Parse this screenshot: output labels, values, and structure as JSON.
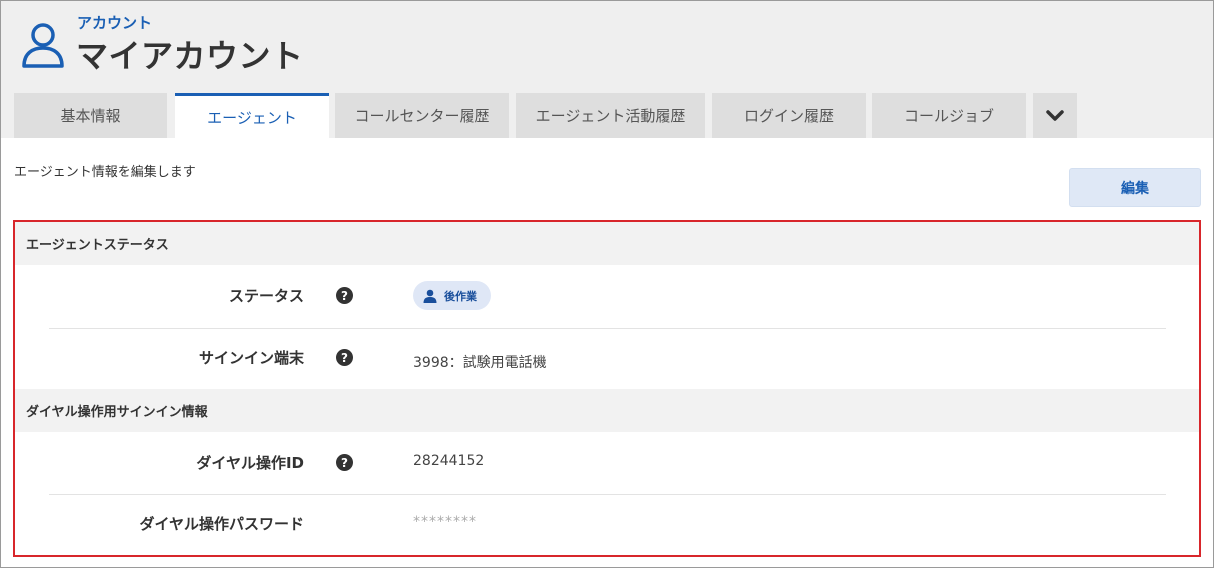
{
  "header": {
    "breadcrumb": "アカウント",
    "title": "マイアカウント",
    "icon": "user-icon"
  },
  "tabs": [
    {
      "label": "基本情報",
      "active": false
    },
    {
      "label": "エージェント",
      "active": true
    },
    {
      "label": "コールセンター履歴",
      "active": false
    },
    {
      "label": "エージェント活動履歴",
      "active": false
    },
    {
      "label": "ログイン履歴",
      "active": false
    },
    {
      "label": "コールジョブ",
      "active": false
    }
  ],
  "tabs_more_icon": "chevron-down-icon",
  "description": "エージェント情報を編集します",
  "edit_button": "編集",
  "sections": [
    {
      "title": "エージェントステータス",
      "rows": [
        {
          "label": "ステータス",
          "help": true,
          "value": "後作業",
          "value_icon": "user-icon"
        },
        {
          "label": "サインイン端末",
          "help": true,
          "value": "3998：試験用電話機"
        }
      ]
    },
    {
      "title": "ダイヤル操作用サインイン情報",
      "rows": [
        {
          "label": "ダイヤル操作ID",
          "help": true,
          "value": "28244152"
        },
        {
          "label": "ダイヤル操作パスワード",
          "help": false,
          "value": "********"
        }
      ]
    }
  ],
  "colors": {
    "accent": "#1a5fb4",
    "highlight_border": "#d8262b",
    "badge_bg": "#dfe7f6"
  }
}
